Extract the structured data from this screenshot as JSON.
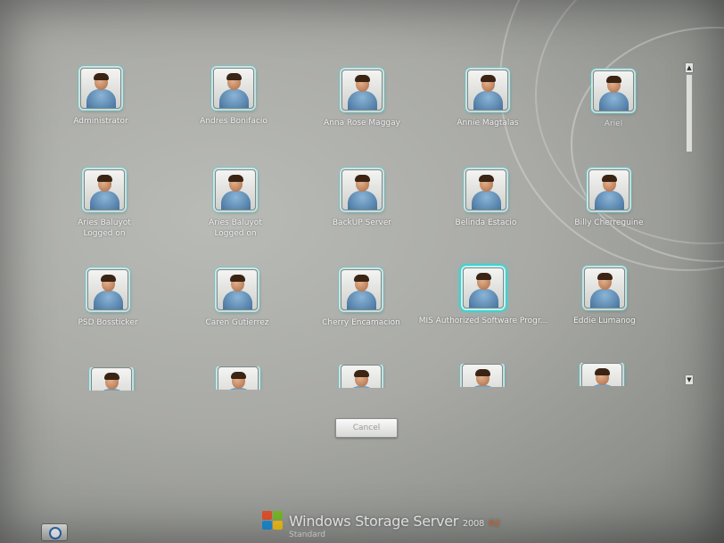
{
  "users": [
    {
      "name": "Administrator"
    },
    {
      "name": "Andres Bonifacio"
    },
    {
      "name": "Anna Rose Maggay"
    },
    {
      "name": "Annie Magtalas"
    },
    {
      "name": "Ariel"
    },
    {
      "name": "Aries Baluyot",
      "status": "Logged on"
    },
    {
      "name": "Aries Baluyot",
      "status": "Logged on"
    },
    {
      "name": "BackUP Server"
    },
    {
      "name": "Belinda Estacio"
    },
    {
      "name": "Billy Cherreguine"
    },
    {
      "name": "PSD Bossticker"
    },
    {
      "name": "Caren Gutierrez"
    },
    {
      "name": "Cherry Encamacion"
    },
    {
      "name": "MIS Authorized Software Progr...",
      "selected": true
    },
    {
      "name": "Eddie Lumanog"
    }
  ],
  "cancel_label": "Cancel",
  "branding": {
    "product": "Windows Storage Server",
    "version": "2008",
    "suffix": "R2",
    "edition": "Standard"
  },
  "icons": [
    "user-avatar-icon",
    "windows-flag-icon",
    "ease-of-access-icon",
    "scroll-up-icon",
    "scroll-down-icon"
  ]
}
